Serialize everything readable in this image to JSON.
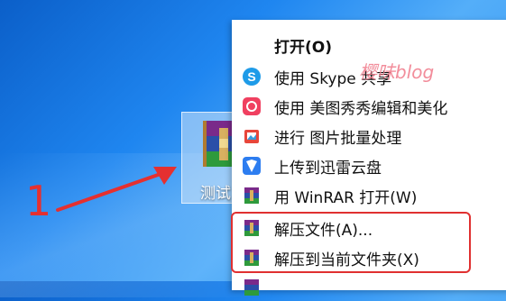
{
  "desktop": {
    "file_label": "测试",
    "annotation_number": "1"
  },
  "watermark": "樱味blog",
  "menu": {
    "items": [
      {
        "label": "打开(O)",
        "icon": "none",
        "bold": true
      },
      {
        "label": "使用 Skype 共享",
        "icon": "skype-icon"
      },
      {
        "label": "使用 美图秀秀编辑和美化",
        "icon": "meitu-icon"
      },
      {
        "label": "进行 图片批量处理",
        "icon": "batch-image-icon"
      },
      {
        "label": "上传到迅雷云盘",
        "icon": "xunlei-icon"
      },
      {
        "label": "用 WinRAR 打开(W)",
        "icon": "winrar-icon"
      },
      {
        "label": "解压文件(A)...",
        "icon": "winrar-icon"
      },
      {
        "label": "解压到当前文件夹(X)",
        "icon": "winrar-icon"
      }
    ]
  },
  "colors": {
    "highlight": "#e03030",
    "annotation": "#e53030",
    "watermark": "#f07a8a"
  }
}
